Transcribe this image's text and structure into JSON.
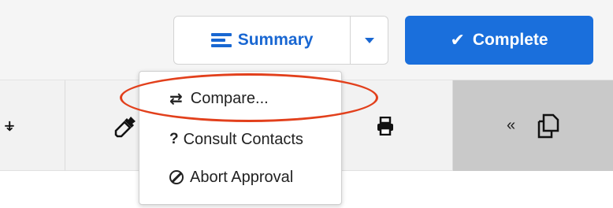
{
  "header": {
    "summary_label": "Summary",
    "complete_label": "Complete",
    "accent_color": "#1967d2",
    "complete_bg": "#1a6fdc"
  },
  "toolbar": {
    "icons": [
      "clipboard-icon",
      "eyedropper-icon",
      "print-icon",
      "collapse-icon",
      "copy-icon"
    ],
    "collapse_glyph": "«"
  },
  "dropdown": {
    "items": [
      {
        "label": "Compare...",
        "icon": "swap-arrows-icon"
      },
      {
        "label": "Consult Contacts",
        "icon": "question-icon"
      },
      {
        "label": "Abort Approval",
        "icon": "prohibited-icon"
      }
    ]
  },
  "annotation": {
    "highlight_color": "#e2401c",
    "highlighted_item": "Compare..."
  }
}
